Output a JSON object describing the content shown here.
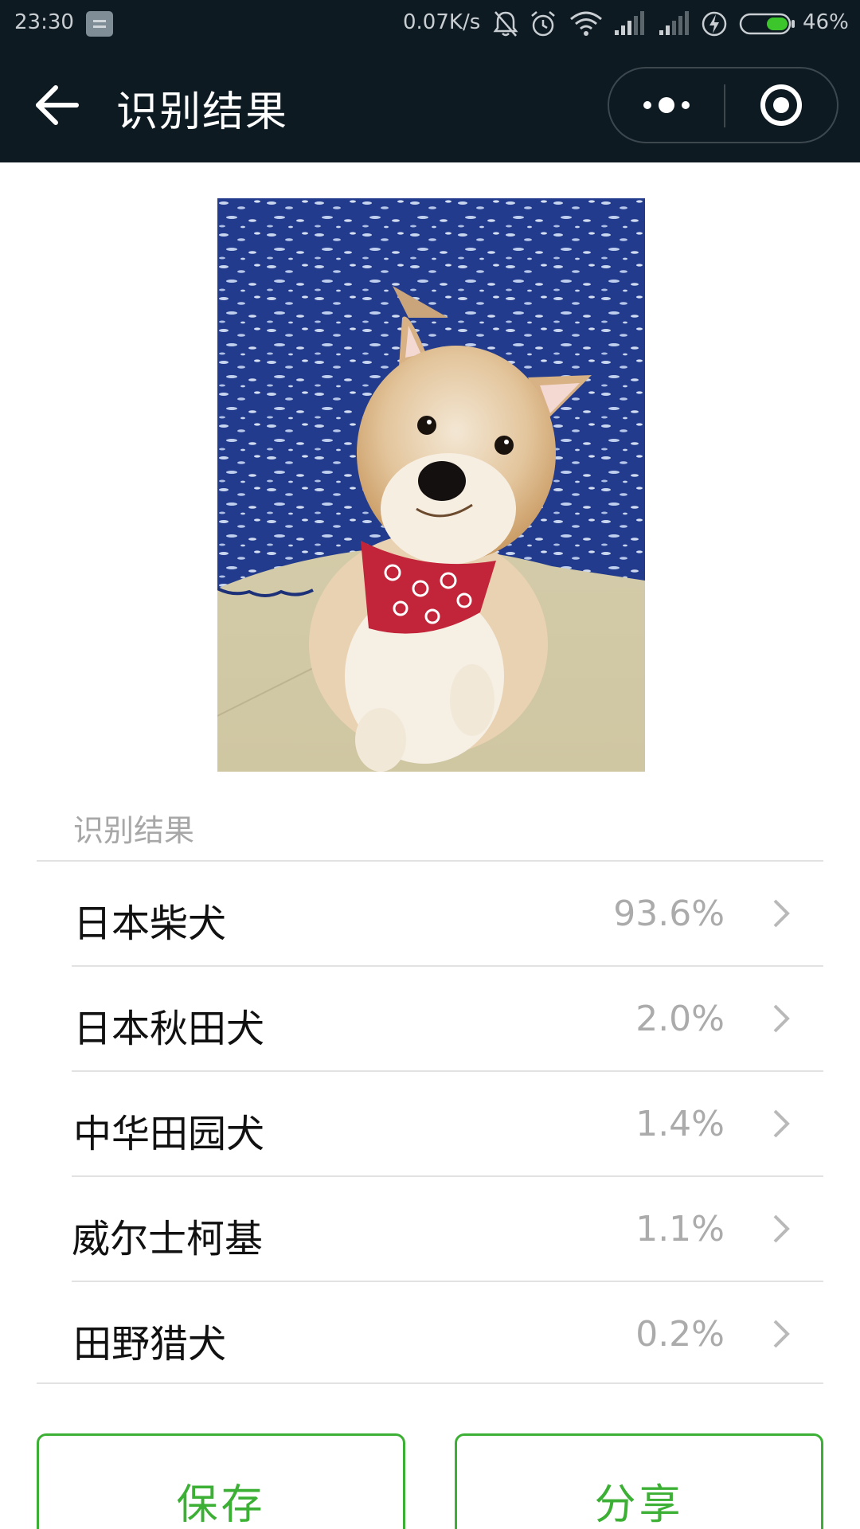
{
  "status_bar": {
    "time": "23:30",
    "network_speed": "0.07K/s",
    "battery_percent": "46%",
    "battery_level": 0.46,
    "icons": [
      "notification-icon",
      "bell-muted-icon",
      "alarm-icon",
      "wifi-icon",
      "signal-icon",
      "signal-icon",
      "charging-icon",
      "battery-icon"
    ]
  },
  "nav": {
    "title": "识别结果",
    "back_icon": "back-arrow-icon",
    "more_icon": "more-dots-icon",
    "close_icon": "target-circle-icon"
  },
  "photo": {
    "subject": "shiba-dog-photo"
  },
  "results": {
    "section_label": "识别结果",
    "items": [
      {
        "name": "日本柴犬",
        "percent": "93.6%"
      },
      {
        "name": "日本秋田犬",
        "percent": "2.0%"
      },
      {
        "name": "中华田园犬",
        "percent": "1.4%"
      },
      {
        "name": "威尔士柯基",
        "percent": "1.1%"
      },
      {
        "name": "田野猎犬",
        "percent": "0.2%"
      }
    ]
  },
  "actions": {
    "save_label": "保存",
    "share_label": "分享"
  },
  "colors": {
    "bar_background": "#0d1a22",
    "accent_green": "#3cb035",
    "text_gray": "#ababab"
  }
}
